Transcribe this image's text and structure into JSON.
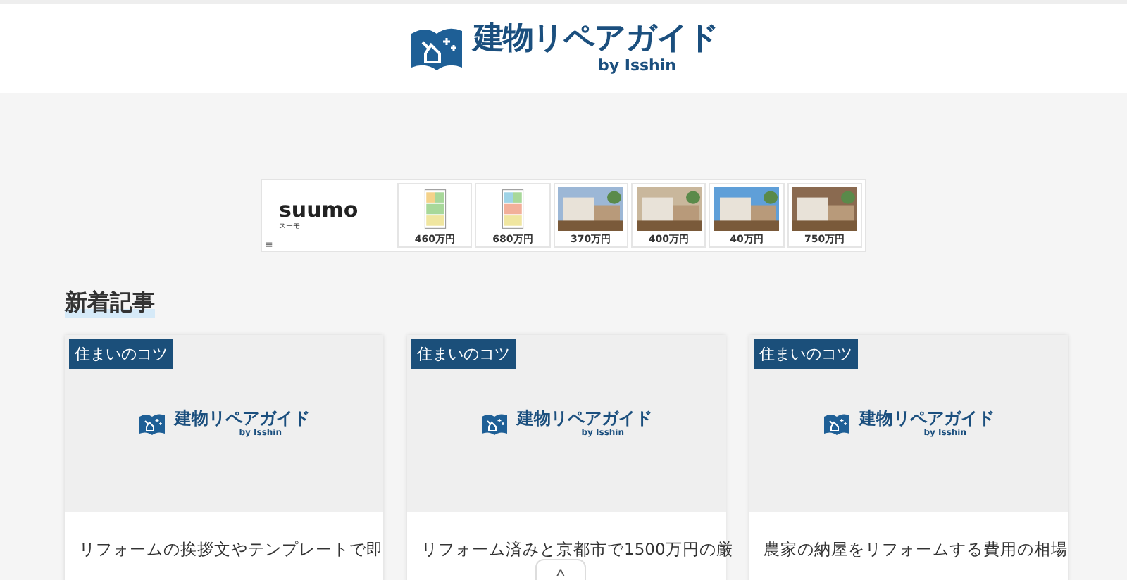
{
  "header": {
    "logo_title": "建物リペアガイド",
    "logo_sub": "by Isshin"
  },
  "ad": {
    "brand": "suumo",
    "brand_sub": "スーモ",
    "menu": "≡",
    "items": [
      {
        "kind": "floorplan",
        "price": "460万円"
      },
      {
        "kind": "floorplan",
        "price": "680万円"
      },
      {
        "kind": "picture",
        "price": "370万円"
      },
      {
        "kind": "picture",
        "price": "400万円"
      },
      {
        "kind": "picture",
        "price": "40万円"
      },
      {
        "kind": "picture",
        "price": "750万円"
      }
    ]
  },
  "section_title": "新着記事",
  "cards": [
    {
      "category": "住まいのコツ",
      "logo_title": "建物リペアガイド",
      "logo_sub": "by Isshin",
      "title": "リフォームの挨拶文やテンプレートで即"
    },
    {
      "category": "住まいのコツ",
      "logo_title": "建物リペアガイド",
      "logo_sub": "by Isshin",
      "title": "リフォーム済みと京都市で1500万円の厳"
    },
    {
      "category": "住まいのコツ",
      "logo_title": "建物リペアガイド",
      "logo_sub": "by Isshin",
      "title": "農家の納屋をリフォームする費用の相場"
    }
  ],
  "scroll_top": "^"
}
